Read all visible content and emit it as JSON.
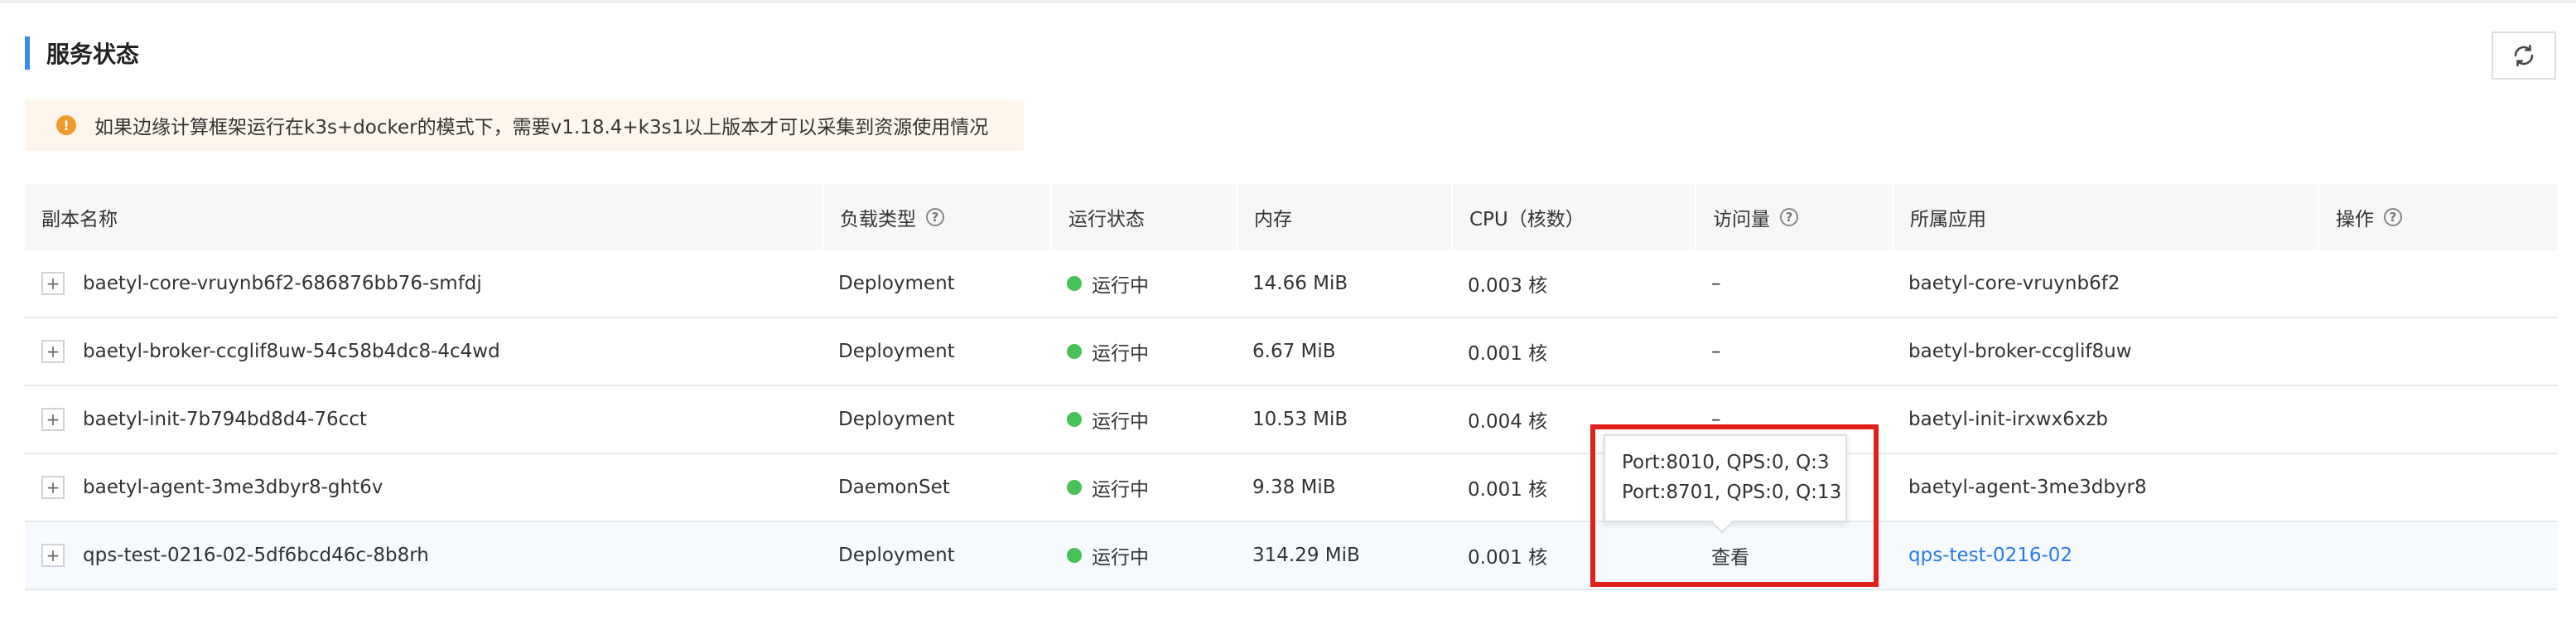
{
  "section": {
    "title": "服务状态"
  },
  "refresh_icon": "refresh-icon",
  "alert": {
    "icon": "warning-icon",
    "text": "如果边缘计算框架运行在k3s+docker的模式下，需要v1.18.4+k3s1以上版本才可以采集到资源使用情况"
  },
  "colors": {
    "accent": "#3b8beb",
    "running": "#45c155",
    "link": "#2a7be6",
    "highlight": "#e0201b"
  },
  "table": {
    "headers": {
      "name": "副本名称",
      "workload": "负载类型",
      "status": "运行状态",
      "memory": "内存",
      "cpu": "CPU（核数）",
      "traffic": "访问量",
      "app": "所属应用",
      "ops": "操作"
    },
    "rows": [
      {
        "name": "baetyl-core-vruynb6f2-686876bb76-smfdj",
        "workload": "Deployment",
        "status": "运行中",
        "memory": "14.66 MiB",
        "cpu": "0.003 核",
        "traffic": "–",
        "app": "baetyl-core-vruynb6f2"
      },
      {
        "name": "baetyl-broker-ccglif8uw-54c58b4dc8-4c4wd",
        "workload": "Deployment",
        "status": "运行中",
        "memory": "6.67 MiB",
        "cpu": "0.001 核",
        "traffic": "–",
        "app": "baetyl-broker-ccglif8uw"
      },
      {
        "name": "baetyl-init-7b794bd8d4-76cct",
        "workload": "Deployment",
        "status": "运行中",
        "memory": "10.53 MiB",
        "cpu": "0.004 核",
        "traffic": "–",
        "app": "baetyl-init-irxwx6xzb"
      },
      {
        "name": "baetyl-agent-3me3dbyr8-ght6v",
        "workload": "DaemonSet",
        "status": "运行中",
        "memory": "9.38 MiB",
        "cpu": "0.001 核",
        "traffic": "",
        "app": "baetyl-agent-3me3dbyr8"
      },
      {
        "name": "qps-test-0216-02-5df6bcd46c-8b8rh",
        "workload": "Deployment",
        "status": "运行中",
        "memory": "314.29 MiB",
        "cpu": "0.001 核",
        "traffic": "查看",
        "app": "qps-test-0216-02"
      }
    ]
  },
  "tooltip": {
    "lines": [
      "Port:8010, QPS:0, Q:3",
      "Port:8701, QPS:0, Q:13"
    ]
  }
}
